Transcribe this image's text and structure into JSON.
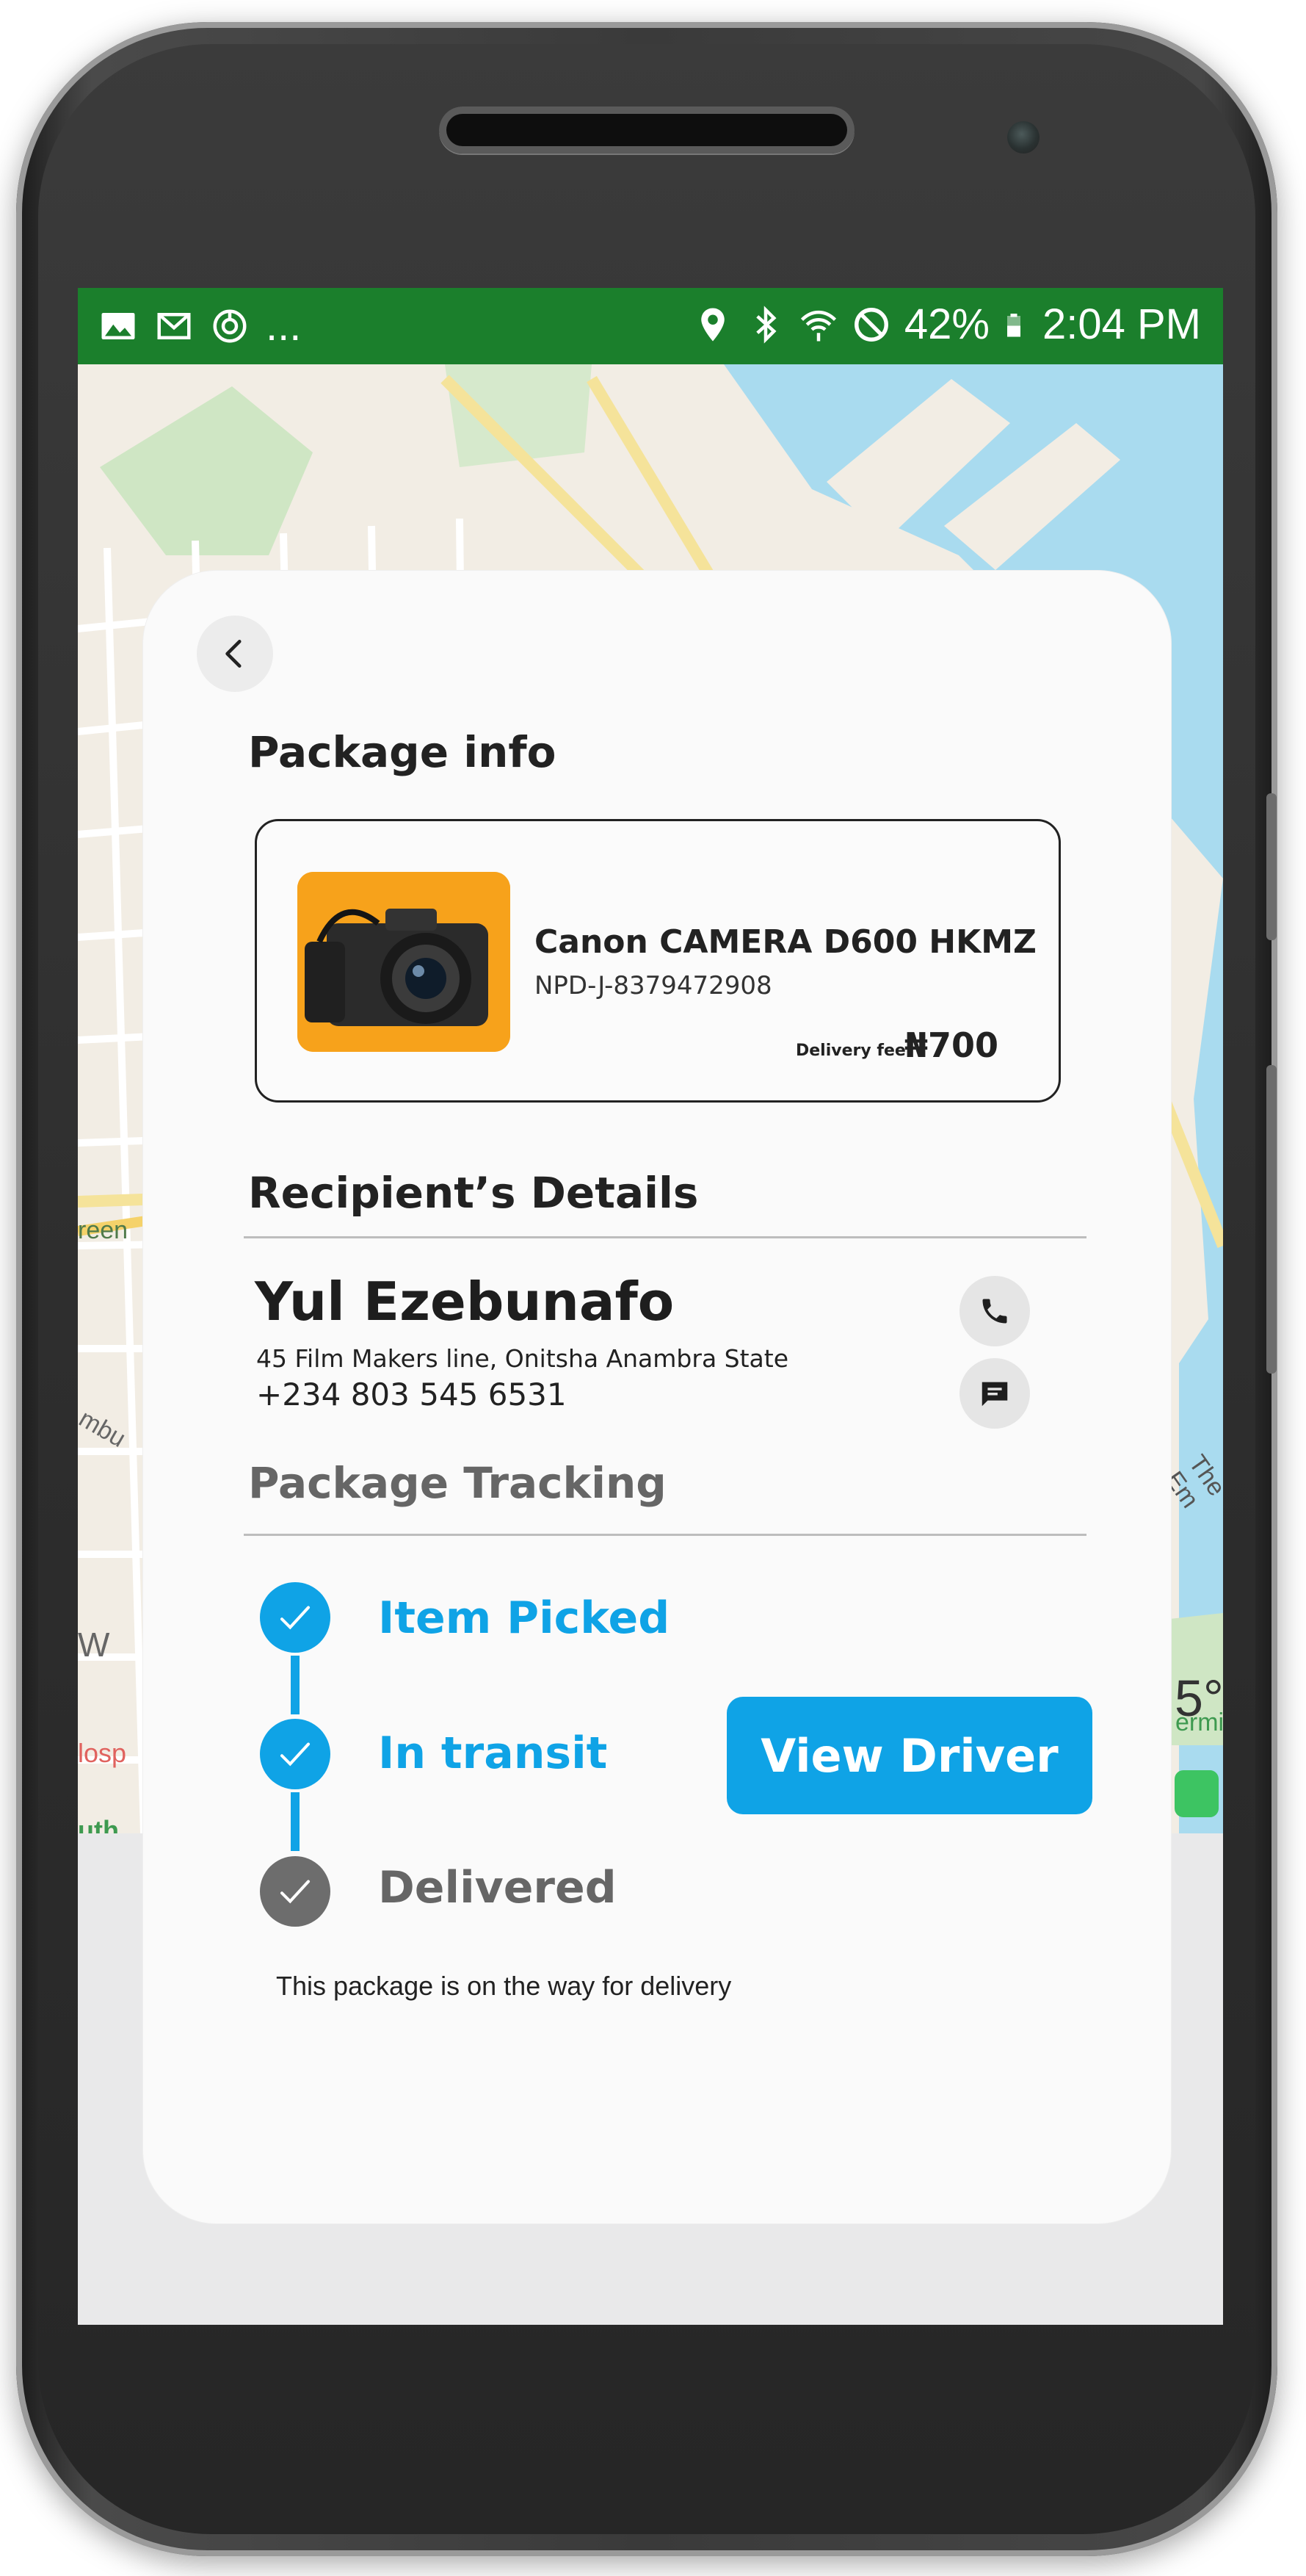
{
  "status_bar": {
    "overflow": "...",
    "battery": "42%",
    "time": "2:04 PM",
    "left_icons": [
      "gallery-icon",
      "gmail-icon",
      "sync-icon"
    ],
    "right_icons": [
      "location-icon",
      "bluetooth-icon",
      "wifi-icon",
      "block-icon",
      "battery-icon"
    ]
  },
  "map_labels": {
    "green": "reen",
    "street": "mbu",
    "hospital": "losp",
    "south": "uth",
    "west": "W",
    "embarcadero": "The Em",
    "terminal": "ermi",
    "degree": "5°"
  },
  "package_info": {
    "title": "Package info",
    "item_name": "Canon CAMERA D600 HKMZ",
    "tracking_code": "NPD-J-8379472908",
    "fee_label": "Delivery fee",
    "fee_value": "₦700",
    "image_icon": "camera-photo"
  },
  "recipient": {
    "title": "Recipient’s Details",
    "name": "Yul Ezebunafo",
    "address": "45 Film Makers line, Onitsha Anambra State",
    "phone": "+234 803 545 6531"
  },
  "tracking": {
    "title": "Package Tracking",
    "steps": [
      {
        "label": "Item Picked",
        "done": true
      },
      {
        "label": "In transit",
        "done": true
      },
      {
        "label": "Delivered",
        "done": false
      }
    ],
    "view_driver_label": "View Driver",
    "note": "This package is on the way for delivery"
  },
  "colors": {
    "status_bar": "#1b7f2c",
    "accent": "#0fa3e6",
    "pending": "#6d6d6d",
    "camera_bg": "#f7a21b"
  }
}
